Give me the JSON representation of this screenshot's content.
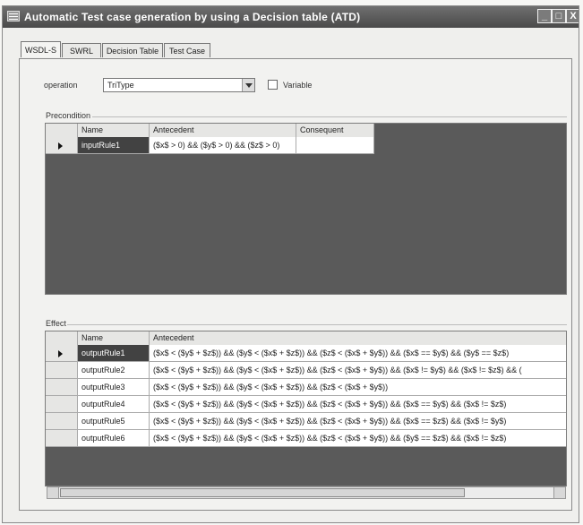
{
  "window": {
    "title": "Automatic Test case generation by using a Decision table (ATD)",
    "buttons": {
      "minimize": "_",
      "maximize": "□",
      "close": "X"
    }
  },
  "tabs": [
    "WSDL-S",
    "SWRL",
    "Decision Table",
    "Test Case"
  ],
  "form": {
    "operation_label": "operation",
    "operation_value": "TriType",
    "variable_label": "Variable"
  },
  "precondition": {
    "label": "Precondition",
    "columns": [
      "Name",
      "Antecedent",
      "Consequent"
    ],
    "rows": [
      {
        "name": "inputRule1",
        "antecedent": "($x$ > 0) && ($y$ > 0) && ($z$ > 0)",
        "consequent": ""
      }
    ]
  },
  "effect": {
    "label": "Effect",
    "columns": [
      "Name",
      "Antecedent"
    ],
    "rows": [
      {
        "name": "outputRule1",
        "antecedent": "($x$ < ($y$ + $z$)) && ($y$ < ($x$ + $z$)) && ($z$ < ($x$ + $y$)) && ($x$ == $y$) && ($y$ == $z$)"
      },
      {
        "name": "outputRule2",
        "antecedent": "($x$ < ($y$ + $z$)) && ($y$ < ($x$ + $z$)) && ($z$ < ($x$ + $y$)) && ($x$ != $y$) && ($x$ != $z$) && ("
      },
      {
        "name": "outputRule3",
        "antecedent": "($x$ < ($y$ + $z$)) && ($y$ < ($x$ + $z$)) && ($z$ < ($x$ + $y$))"
      },
      {
        "name": "outputRule4",
        "antecedent": "($x$ < ($y$ + $z$)) && ($y$ < ($x$ + $z$)) && ($z$ < ($x$ + $y$)) && ($x$ == $y$) && ($x$ != $z$)"
      },
      {
        "name": "outputRule5",
        "antecedent": "($x$ < ($y$ + $z$)) && ($y$ < ($x$ + $z$)) && ($z$ < ($x$ + $y$)) && ($x$ == $z$) && ($x$ != $y$)"
      },
      {
        "name": "outputRule6",
        "antecedent": "($x$ < ($y$ + $z$)) && ($y$ < ($x$ + $z$)) && ($z$ < ($x$ + $y$)) && ($y$ == $z$) && ($x$ != $z$)"
      }
    ]
  },
  "colors": {
    "titlebar": "#555555",
    "grid_background": "#5a5a5a",
    "selected_cell": "#424242"
  }
}
